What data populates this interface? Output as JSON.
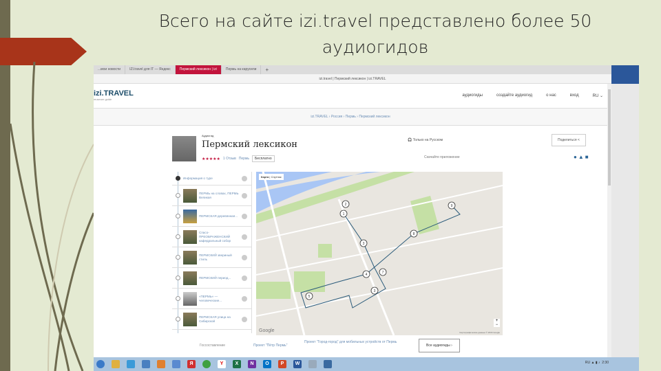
{
  "slide": {
    "title_line1": "Всего на сайте izi.travel представлено более 50",
    "title_line2": "аудиогидов"
  },
  "browser": {
    "tabs": [
      {
        "label": "...мои новости"
      },
      {
        "label": "IZI.travel для IT — Яндекс"
      },
      {
        "label": "Пермский лексикон | izi",
        "active": true
      },
      {
        "label": "Пермь на карусели"
      }
    ],
    "address": "izi.travel | Пермский лексикон | izi.TRAVEL"
  },
  "site": {
    "logo": "izi.TRAVEL",
    "logo_sub": "museum guide",
    "nav": [
      "аудиогиды",
      "создайте аудиогид",
      "о нас",
      "вход",
      "RU ⌄"
    ],
    "breadcrumb": "izi.TRAVEL › Россия › Пермь › Пермский лексикон"
  },
  "tour": {
    "category": "Аудиогид",
    "name": "Пермский лексикон",
    "stars": "★★★★★",
    "reviews": "1 Отзыв",
    "city": "Пермь",
    "price": "Бесплатно",
    "language": "Только на Русском",
    "share": "Поделиться",
    "store": "Скачайте приложение"
  },
  "stops": [
    {
      "label": "Информация о туре"
    },
    {
      "label": "ПЕРМЬ на словах, ПЕРМЬ Великая"
    },
    {
      "label": "ПЕРМСКАЯ деревянная..."
    },
    {
      "label": "Спасо-ПРЕОБРАЖЕНСКИЙ кафедральный собор"
    },
    {
      "label": "ПЕРМСКИЙ звериный стиль"
    },
    {
      "label": "ПЕРМСКИЙ период..."
    },
    {
      "label": "«ПЕРМЬ» — человеческие..."
    },
    {
      "label": "ПЕРМСКАЯ улица на Сибирской"
    }
  ],
  "map": {
    "tab_map": "Карта",
    "tab_sat": "Спутник",
    "google": "Google",
    "copyright": "Картографические данные © 2016 Google",
    "markers": [
      "2",
      "1",
      "3",
      "8",
      "9",
      "7",
      "4",
      "3",
      "5"
    ]
  },
  "footer": {
    "link1": "Госсоставление",
    "link2": "Проект \"Пётр Пермь\"",
    "link3": "Проект \"Город-город\" для мобильных устройств от Пермь",
    "more": "Все аудиогиды ›"
  },
  "tray": {
    "lang": "RU",
    "time": "2:30"
  }
}
